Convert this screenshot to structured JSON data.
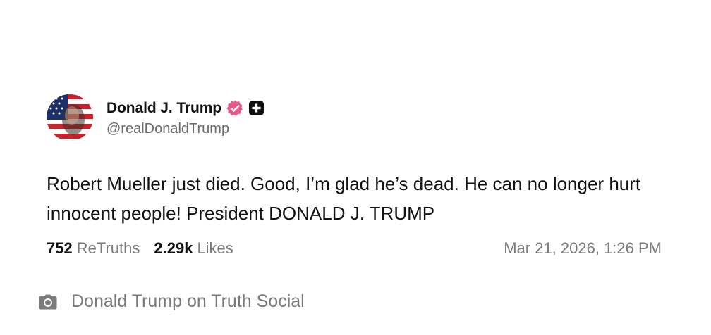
{
  "post": {
    "display_name": "Donald J. Trump",
    "handle": "@realDonaldTrump",
    "body": "Robert Mueller just died. Good, I’m glad he’s dead. He can no longer hurt innocent people! President DONALD J. TRUMP",
    "retruths_count": "752",
    "retruths_label": "ReTruths",
    "likes_count": "2.29k",
    "likes_label": "Likes",
    "timestamp": "Mar 21, 2026, 1:26 PM"
  },
  "caption": {
    "text": "Donald Trump on Truth Social",
    "icon": "camera-icon"
  },
  "icons": {
    "verified": "verified-badge-icon",
    "plus": "plus-badge-icon"
  },
  "colors": {
    "verified_badge": "#e8588a",
    "text_primary": "#111111",
    "text_secondary": "#7a7a7a"
  }
}
